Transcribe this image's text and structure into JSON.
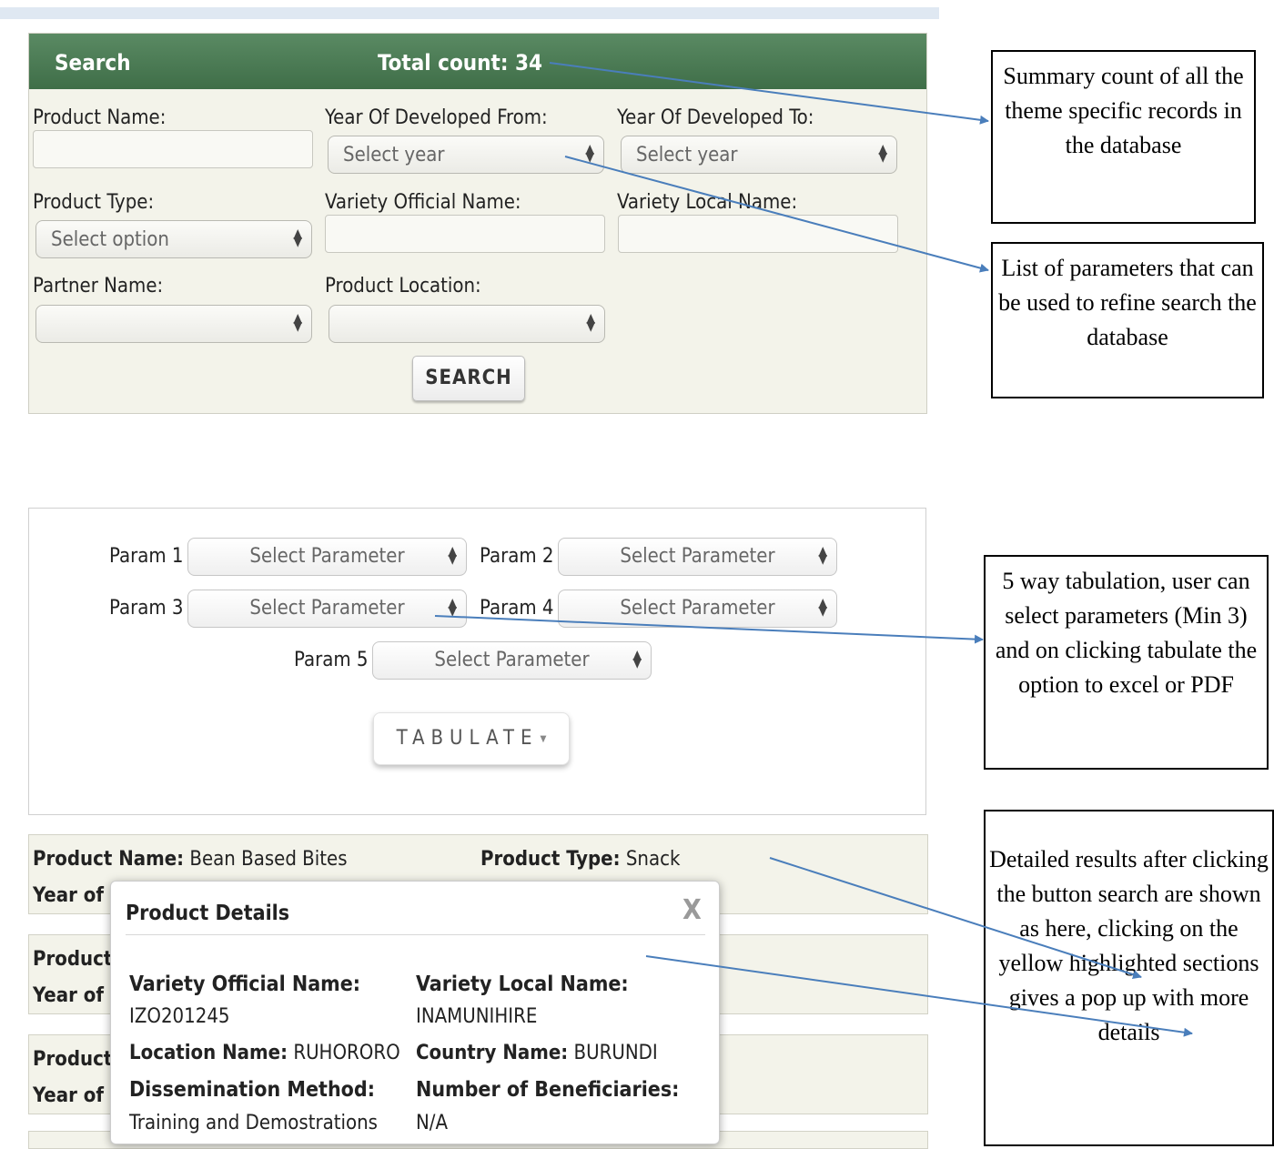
{
  "search": {
    "title": "Search",
    "total_count": "Total count: 34",
    "fields": {
      "product_name": "Product Name:",
      "year_from": "Year Of Developed From:",
      "year_to": "Year Of Developed To:",
      "product_type": "Product Type:",
      "variety_official": "Variety Official Name:",
      "variety_local": "Variety Local Name:",
      "partner_name": "Partner Name:",
      "product_location": "Product Location:"
    },
    "selects": {
      "year_from": "Select year",
      "year_to": "Select year",
      "product_type": "Select option",
      "partner_name": "",
      "product_location": ""
    },
    "button": "SEARCH"
  },
  "tabulation": {
    "params": [
      {
        "label": "Param 1",
        "value": "Select Parameter"
      },
      {
        "label": "Param 2",
        "value": "Select Parameter"
      },
      {
        "label": "Param 3",
        "value": "Select Parameter"
      },
      {
        "label": "Param 4",
        "value": "Select Parameter"
      },
      {
        "label": "Param 5",
        "value": "Select Parameter"
      }
    ],
    "button": "TABULATE"
  },
  "results": {
    "card1": {
      "name_label": "Product Name:",
      "name_value": "Bean Based Bites",
      "type_label": "Product Type:",
      "type_value": "Snack",
      "year_label": "Year of"
    },
    "card2": {
      "name_label": "Product",
      "year_label": "Year of"
    },
    "card3": {
      "name_label": "Product",
      "year_label": "Year of"
    }
  },
  "popup": {
    "title": "Product Details",
    "close": "X",
    "variety_official_label": "Variety Official Name:",
    "variety_official_value": "IZO201245",
    "variety_local_label": "Variety Local Name:",
    "variety_local_value": "INAMUNIHIRE",
    "location_label": "Location Name:",
    "location_value": "RUHORORO",
    "country_label": "Country Name:",
    "country_value": "BURUNDI",
    "dissemination_label": "Dissemination Method:",
    "dissemination_value": "Training and Demostrations",
    "beneficiaries_label": "Number of Beneficiaries:",
    "beneficiaries_value": "N/A"
  },
  "callouts": {
    "summary": "Summary count of all the theme specific records in the database",
    "parameters": "List of parameters that can be used to refine search the database",
    "tabulation": "5 way tabulation, user can select parameters (Min 3) and on clicking tabulate the option to excel or PDF",
    "results": "Detailed results after clicking the button search are shown as here, clicking on the yellow highlighted sections gives a pop up with more details"
  },
  "colors": {
    "header_green": "#4a7a52",
    "panel_bg": "#f3f3ea",
    "arrow_blue": "#4a7ebb"
  }
}
